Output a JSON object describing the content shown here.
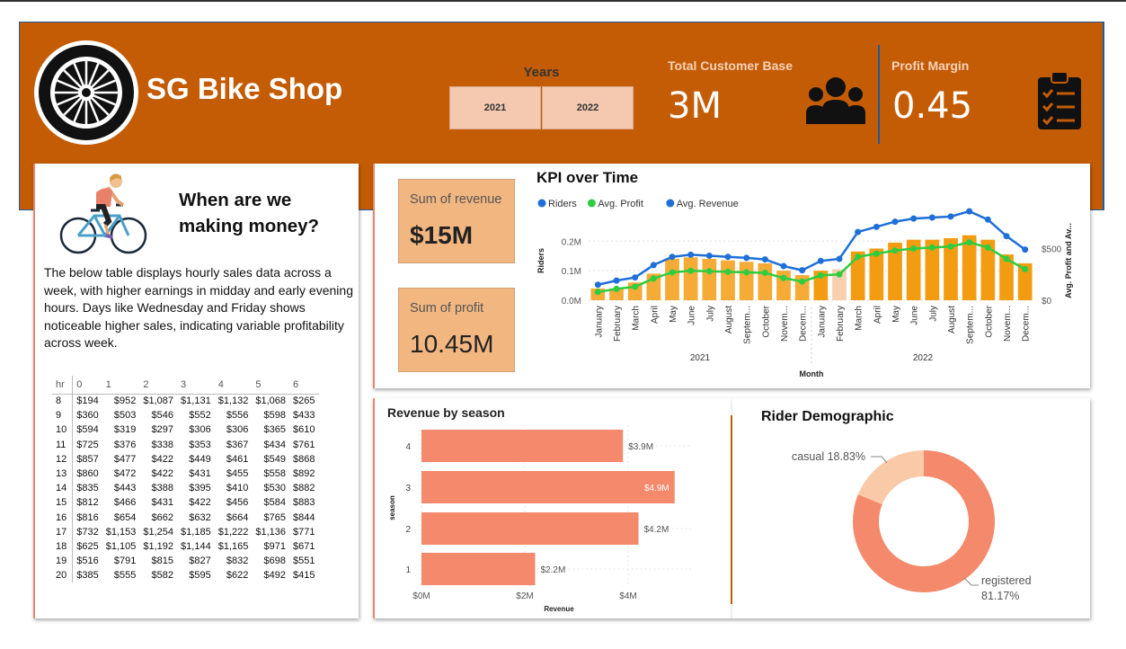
{
  "header": {
    "shop_name": "SG Bike Shop",
    "years_label": "Years",
    "years": [
      "2021",
      "2022"
    ],
    "customer_label": "Total Customer Base",
    "customer_value": "3M",
    "margin_label": "Profit Margin",
    "margin_value": "0.45"
  },
  "left_panel": {
    "title": "When are we making money?",
    "description": "The below table displays hourly sales data across a week, with higher earnings in midday and early evening hours. Days like Wednesday and Friday shows noticeable higher sales, indicating variable profitability across week.",
    "table_corner": "hr",
    "columns": [
      "0",
      "1",
      "2",
      "3",
      "4",
      "5",
      "6"
    ],
    "rows": [
      {
        "hr": "8",
        "vals": [
          "$194",
          "$952",
          "$1,087",
          "$1,131",
          "$1,132",
          "$1,068",
          "$265"
        ]
      },
      {
        "hr": "9",
        "vals": [
          "$360",
          "$503",
          "$546",
          "$552",
          "$556",
          "$598",
          "$433"
        ]
      },
      {
        "hr": "10",
        "vals": [
          "$594",
          "$319",
          "$297",
          "$306",
          "$306",
          "$365",
          "$610"
        ]
      },
      {
        "hr": "11",
        "vals": [
          "$725",
          "$376",
          "$338",
          "$353",
          "$367",
          "$434",
          "$761"
        ]
      },
      {
        "hr": "12",
        "vals": [
          "$857",
          "$477",
          "$422",
          "$449",
          "$461",
          "$549",
          "$868"
        ]
      },
      {
        "hr": "13",
        "vals": [
          "$860",
          "$472",
          "$422",
          "$431",
          "$455",
          "$558",
          "$892"
        ]
      },
      {
        "hr": "14",
        "vals": [
          "$835",
          "$443",
          "$388",
          "$395",
          "$410",
          "$530",
          "$882"
        ]
      },
      {
        "hr": "15",
        "vals": [
          "$812",
          "$466",
          "$431",
          "$422",
          "$456",
          "$584",
          "$883"
        ]
      },
      {
        "hr": "16",
        "vals": [
          "$816",
          "$654",
          "$662",
          "$632",
          "$664",
          "$765",
          "$844"
        ]
      },
      {
        "hr": "17",
        "vals": [
          "$732",
          "$1,153",
          "$1,254",
          "$1,185",
          "$1,222",
          "$1,136",
          "$771"
        ]
      },
      {
        "hr": "18",
        "vals": [
          "$625",
          "$1,105",
          "$1,192",
          "$1,144",
          "$1,165",
          "$971",
          "$671"
        ]
      },
      {
        "hr": "19",
        "vals": [
          "$516",
          "$791",
          "$815",
          "$827",
          "$832",
          "$698",
          "$551"
        ]
      },
      {
        "hr": "20",
        "vals": [
          "$385",
          "$555",
          "$582",
          "$595",
          "$622",
          "$492",
          "$415"
        ]
      }
    ]
  },
  "kpi": {
    "revenue_label": "Sum of revenue",
    "revenue_value": "$15M",
    "profit_label": "Sum of profit",
    "profit_value": "10.45M"
  },
  "chart_data": [
    {
      "type": "bar",
      "title": "KPI over Time",
      "legend": [
        "Riders",
        "Avg. Profit",
        "Avg. Revenue"
      ],
      "legend_position": "top-left",
      "xlabel": "Month",
      "ylabel": "Riders",
      "y2label": "Avg. Profit and Av...",
      "ylim": [
        0,
        0.28
      ],
      "yticks": [
        "0.0M",
        "0.1M",
        "0.2M"
      ],
      "y2lim": [
        0,
        800
      ],
      "y2ticks": [
        "$0",
        "$500"
      ],
      "years": [
        "2021",
        "2022"
      ],
      "categories": [
        "January",
        "February",
        "March",
        "April",
        "May",
        "June",
        "July",
        "August",
        "Septem...",
        "October",
        "Novem...",
        "Decem...",
        "January",
        "February",
        "March",
        "April",
        "May",
        "June",
        "July",
        "August",
        "Septem...",
        "October",
        "Novem...",
        "Decem..."
      ],
      "series": [
        {
          "name": "Riders",
          "kind": "bar",
          "color": "#f39c12",
          "values": [
            0.04,
            0.04,
            0.06,
            0.09,
            0.14,
            0.145,
            0.14,
            0.135,
            0.13,
            0.125,
            0.1,
            0.085,
            0.1,
            0.105,
            0.165,
            0.175,
            0.195,
            0.205,
            0.205,
            0.21,
            0.22,
            0.205,
            0.155,
            0.125
          ]
        },
        {
          "name": "Avg. Profit",
          "kind": "line",
          "color": "#2ecc40",
          "values": [
            80,
            110,
            130,
            210,
            270,
            285,
            280,
            275,
            270,
            265,
            215,
            180,
            240,
            250,
            420,
            450,
            480,
            500,
            510,
            520,
            560,
            510,
            400,
            300
          ]
        },
        {
          "name": "Avg. Revenue",
          "kind": "line",
          "color": "#1f6fd8",
          "values": [
            150,
            190,
            220,
            340,
            420,
            440,
            430,
            420,
            410,
            395,
            330,
            290,
            380,
            400,
            660,
            710,
            760,
            790,
            800,
            810,
            860,
            780,
            620,
            490
          ]
        }
      ]
    },
    {
      "type": "bar",
      "title": "Revenue by season",
      "orientation": "horizontal",
      "xlabel": "Revenue",
      "ylabel": "season",
      "xlim": [
        0,
        5.5
      ],
      "xticks": [
        "$0M",
        "$2M",
        "$4M"
      ],
      "categories": [
        "4",
        "3",
        "2",
        "1"
      ],
      "values": [
        3.9,
        4.9,
        4.2,
        2.2
      ],
      "labels": [
        "$3.9M",
        "$4.9M",
        "$4.2M",
        "$2.2M"
      ],
      "color": "#f4896b"
    },
    {
      "type": "pie",
      "title": "Rider Demographic",
      "categories": [
        "casual",
        "registered"
      ],
      "values": [
        18.83,
        81.17
      ],
      "labels": [
        "casual 18.83%",
        "registered",
        "81.17%"
      ],
      "colors": [
        "#f9c9a8",
        "#f4896b"
      ]
    }
  ]
}
